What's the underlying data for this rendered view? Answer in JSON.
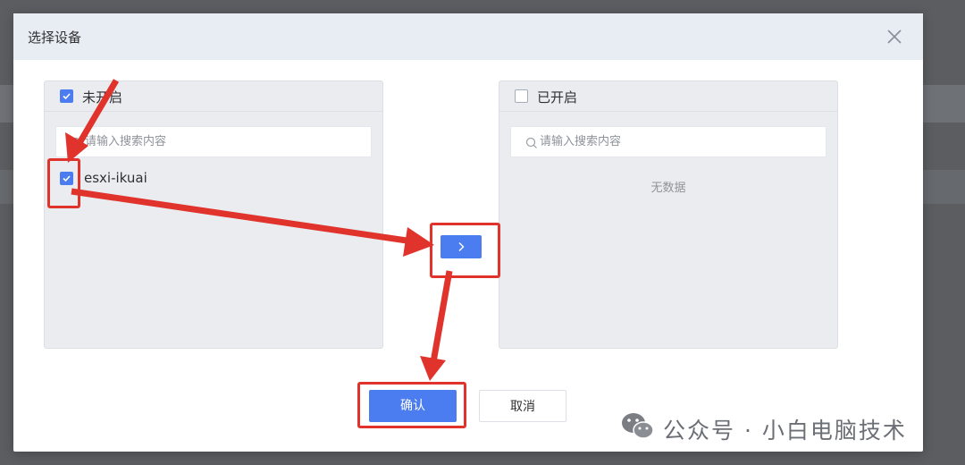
{
  "dialog": {
    "title": "选择设备",
    "close_icon": "close-icon"
  },
  "left_panel": {
    "label": "未开启",
    "select_all_checked": true,
    "search_placeholder": "请输入搜索内容",
    "items": [
      {
        "label": "esxi-ikuai",
        "checked": true
      }
    ]
  },
  "right_panel": {
    "label": "已开启",
    "select_all_checked": false,
    "search_placeholder": "请输入搜索内容",
    "empty_text": "无数据"
  },
  "transfer_button": {
    "icon": "chevron-right-icon"
  },
  "footer": {
    "confirm_label": "确认",
    "cancel_label": "取消"
  },
  "watermark": {
    "text": "公众号 · 小白电脑技术",
    "icon": "wechat-icon"
  },
  "colors": {
    "accent": "#4c7df0",
    "annotation": "#e0332c",
    "header_bg": "#e8ecf3",
    "panel_bg": "#eaecef"
  }
}
